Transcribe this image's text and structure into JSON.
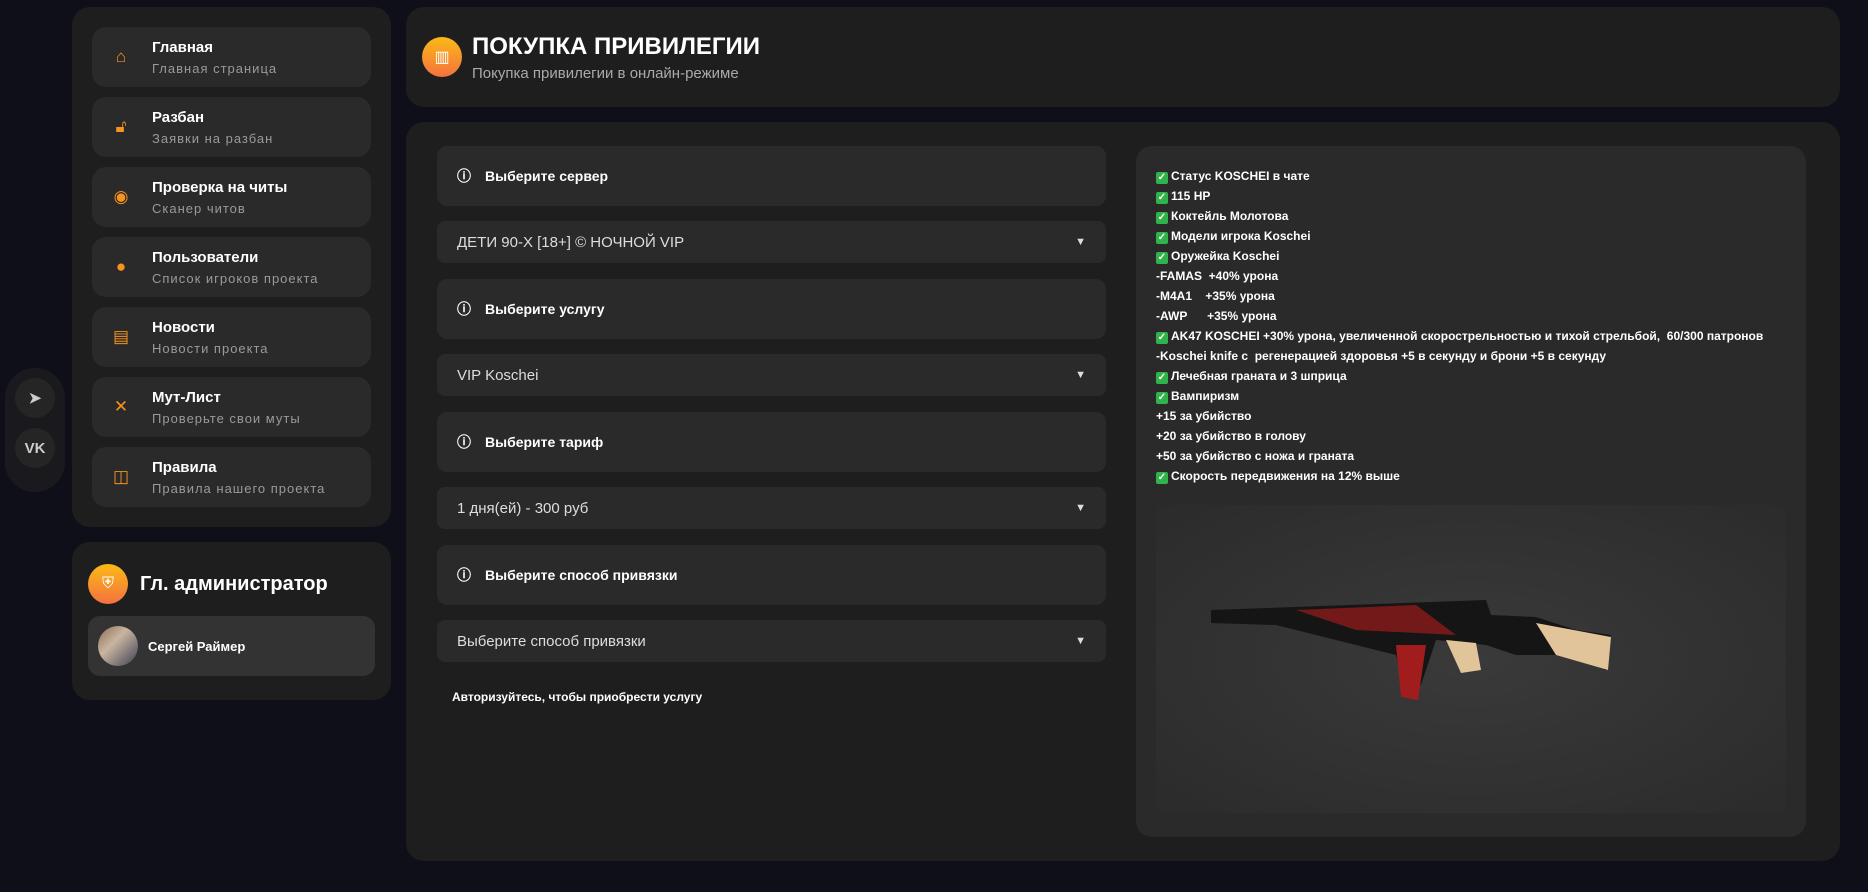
{
  "sidebar": {
    "items": [
      {
        "title": "Главная",
        "subtitle": "Главная страница",
        "icon": "home-icon"
      },
      {
        "title": "Разбан",
        "subtitle": "Заявки на разбан",
        "icon": "unlock-icon"
      },
      {
        "title": "Проверка на читы",
        "subtitle": "Сканер читов",
        "icon": "scanner-icon"
      },
      {
        "title": "Пользователи",
        "subtitle": "Список игроков проекта",
        "icon": "user-icon"
      },
      {
        "title": "Новости",
        "subtitle": "Новости проекта",
        "icon": "news-icon"
      },
      {
        "title": "Мут-Лист",
        "subtitle": "Проверьте свои муты",
        "icon": "mute-icon"
      },
      {
        "title": "Правила",
        "subtitle": "Правила нашего проекта",
        "icon": "rules-icon"
      }
    ]
  },
  "social": {
    "telegram": "telegram-icon",
    "vk": "VK"
  },
  "admin": {
    "title": "Гл. администратор",
    "user": "Сергей Раймер"
  },
  "header": {
    "title": "ПОКУПКА ПРИВИЛЕГИИ",
    "subtitle": "Покупка привилегии в онлайн-режиме"
  },
  "form": {
    "server_label": "Выберите сервер",
    "server_value": "ДЕТИ 90-Х [18+] © НОЧНОЙ VIP",
    "service_label": "Выберите услугу",
    "service_value": "VIP Koschei",
    "tariff_label": "Выберите тариф",
    "tariff_value": "1 дня(ей) - 300 руб",
    "bind_label": "Выберите способ привязки",
    "bind_value": "Выберите способ привязки",
    "auth_note": "Авторизуйтесь, чтобы приобрести услугу"
  },
  "description": [
    {
      "check": true,
      "text": "Статус KOSCHEI в чате"
    },
    {
      "check": true,
      "text": "115 HP"
    },
    {
      "check": true,
      "text": "Коктейль Молотова"
    },
    {
      "check": true,
      "text": "Модели игрока Koschei"
    },
    {
      "check": true,
      "text": "Оружейка Koschei"
    },
    {
      "check": false,
      "text": "-FAMAS  +40% урона"
    },
    {
      "check": false,
      "text": "-M4A1    +35% урона"
    },
    {
      "check": false,
      "text": "-AWP      +35% урона"
    },
    {
      "check": true,
      "text": "AK47 KOSCHEI +30% урона, увеличенной скорострельностью и тихой стрельбой,  60/300 патронов"
    },
    {
      "check": false,
      "text": "-Koschei knife с  регенерацией здоровья +5 в секунду и брони +5 в секунду"
    },
    {
      "check": true,
      "text": "Лечебная граната и 3 шприца"
    },
    {
      "check": true,
      "text": "Вампиризм"
    },
    {
      "check": false,
      "text": "+15 за убийство"
    },
    {
      "check": false,
      "text": "+20 за убийство в голову"
    },
    {
      "check": false,
      "text": "+50 за убийство с ножа и граната"
    },
    {
      "check": true,
      "text": "Скорость передвижения на 12% выше"
    }
  ],
  "colors": {
    "accent": "#f7931e",
    "bg": "#0f0f19",
    "panel": "#1e1e1e"
  }
}
